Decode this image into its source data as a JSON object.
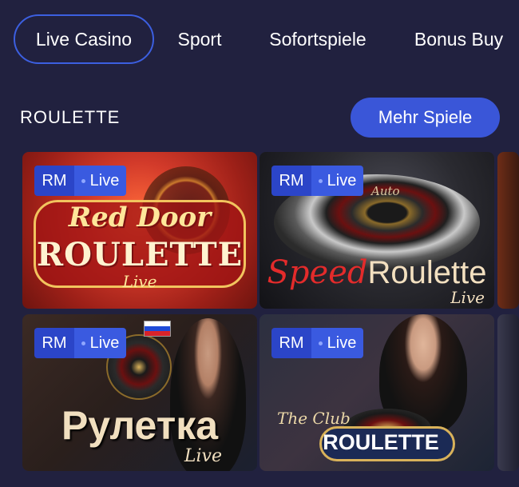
{
  "tabs": [
    {
      "label": "Live Casino",
      "active": true
    },
    {
      "label": "Sport",
      "active": false
    },
    {
      "label": "Sofortspiele",
      "active": false
    },
    {
      "label": "Bonus Buy",
      "active": false
    }
  ],
  "section": {
    "title": "ROULETTE",
    "more_button": "Mehr Spiele"
  },
  "games": [
    {
      "badge_rm": "RM",
      "badge_live": "Live",
      "title_line1": "Red Door",
      "title_line2": "ROULETTE",
      "title_line3": "Live"
    },
    {
      "badge_rm": "RM",
      "badge_live": "Live",
      "title_tag": "Auto",
      "title_speed": "Speed",
      "title_roulette": "Roulette",
      "title_sub": "Live"
    },
    {
      "badge_rm": "RM",
      "badge_live": "Live",
      "title": "Рулетка",
      "title_sub": "Live"
    },
    {
      "badge_rm": "RM",
      "badge_live": "Live",
      "title_club": "The Club",
      "title_roulette": "ROULETTE"
    }
  ],
  "colors": {
    "background": "#21213f",
    "accent": "#3a56d8",
    "badge_rm": "#2b45c8",
    "badge_live": "#3a5ae0"
  }
}
